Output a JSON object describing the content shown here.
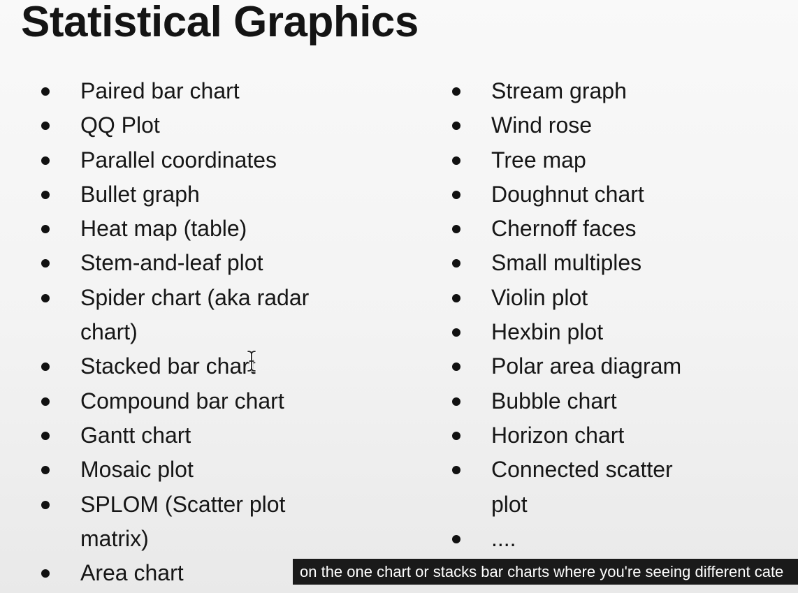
{
  "slide": {
    "title": "Statistical Graphics",
    "left_column": [
      "Paired bar chart",
      "QQ Plot",
      "Parallel coordinates",
      "Bullet graph",
      "Heat map (table)",
      "Stem-and-leaf plot",
      "Spider chart (aka radar",
      "chart)",
      "Stacked bar chart",
      "Compound bar chart",
      "Gantt chart",
      "Mosaic plot",
      "SPLOM (Scatter plot",
      "matrix)",
      "Area chart"
    ],
    "right_column": [
      "Stream graph",
      "Wind rose",
      "Tree map",
      "Doughnut chart",
      "Chernoff faces",
      "Small multiples",
      "Violin plot",
      "Hexbin plot",
      "Polar area diagram",
      "Bubble chart",
      "Horizon chart",
      "Connected scatter",
      "plot",
      "...."
    ]
  },
  "caption": {
    "text": "on the one chart or stacks bar charts where you're seeing different cate"
  },
  "cursor": {
    "icon": "text-cursor-icon"
  }
}
